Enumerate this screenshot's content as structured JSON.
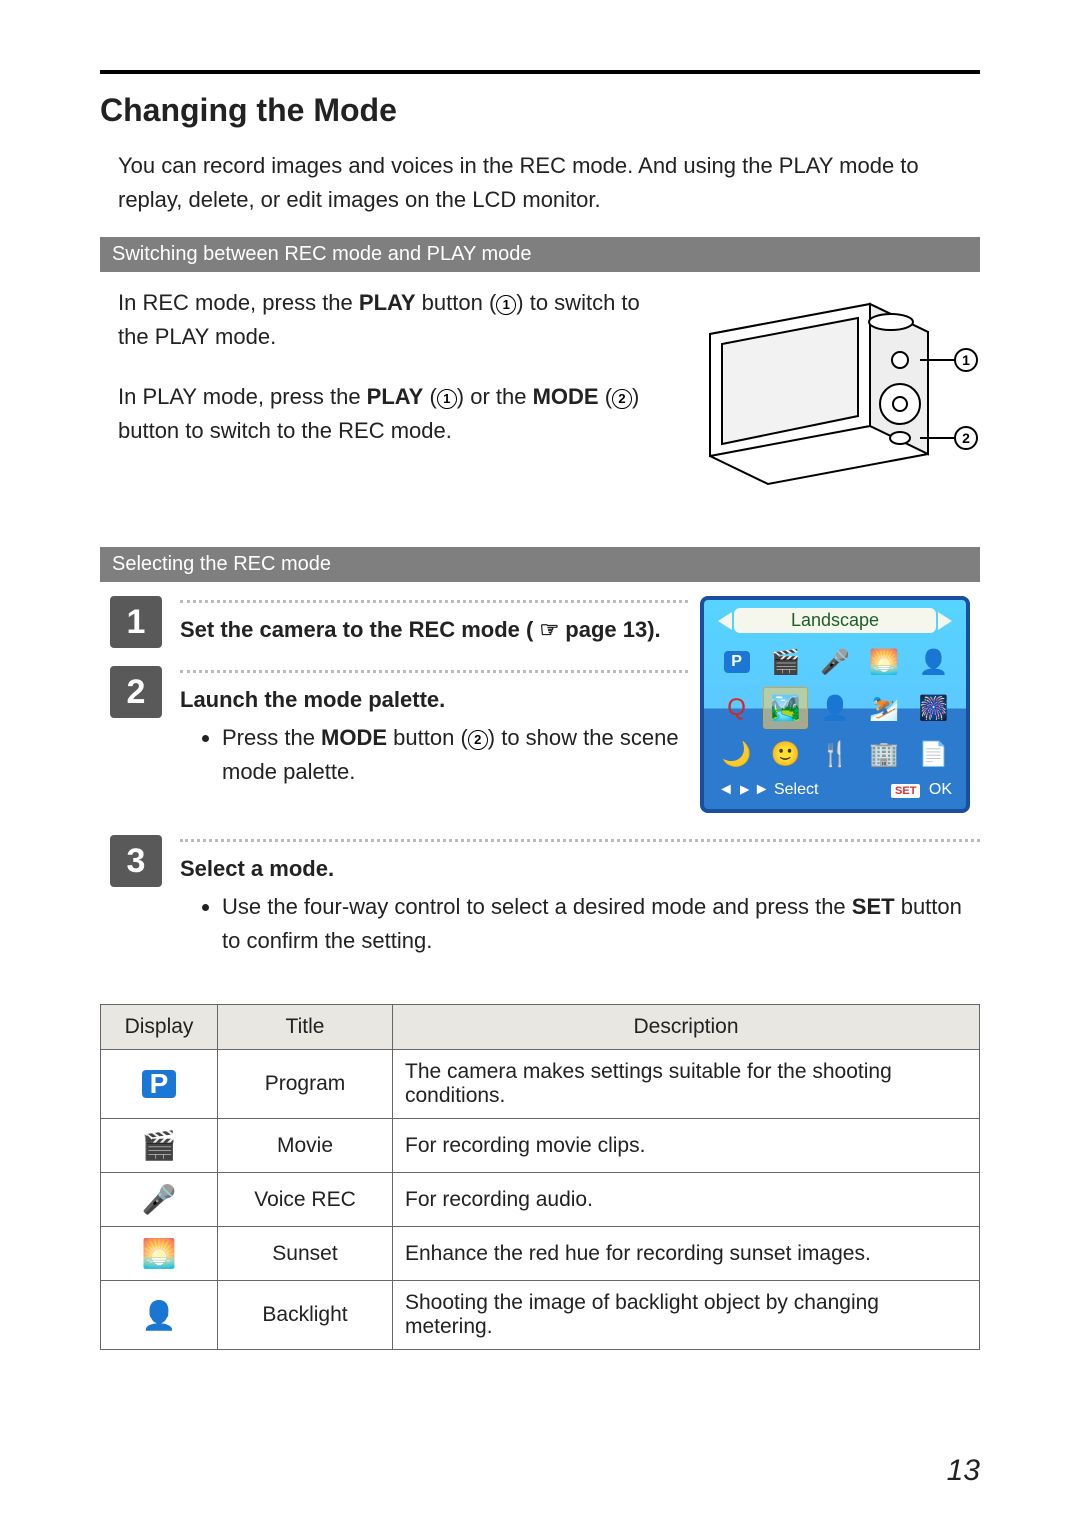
{
  "page_number": "13",
  "title": "Changing the Mode",
  "intro": "You can record images and voices in the REC mode. And using the PLAY mode to replay, delete, or edit images on the LCD monitor.",
  "section1": {
    "heading": "Switching between REC mode and PLAY mode",
    "p1_a": "In REC mode, press the ",
    "p1_b": "PLAY",
    "p1_c": " button (",
    "p1_d": ") to switch to the PLAY mode.",
    "p2_a": "In PLAY mode, press the ",
    "p2_b": "PLAY",
    "p2_c": " (",
    "p2_d": ") or the ",
    "p2_e": "MODE",
    "p2_f": " (",
    "p2_g": ") button to switch to the REC mode.",
    "callout1": "1",
    "callout2": "2"
  },
  "section2": {
    "heading": "Selecting the REC mode",
    "steps": [
      {
        "num": "1",
        "lead": "Set the camera to the REC mode (",
        "trail": "page 13)."
      },
      {
        "num": "2",
        "lead": "Launch the mode palette.",
        "bullet_a": "Press the ",
        "bullet_b": "MODE",
        "bullet_c": " button (",
        "bullet_d": ") to show the scene mode palette."
      },
      {
        "num": "3",
        "lead": "Select a mode.",
        "bullet_a": "Use the four-way control to select a desired mode and press the ",
        "bullet_b": "SET",
        "bullet_c": " button to confirm the setting."
      }
    ],
    "lcd": {
      "title": "Landscape",
      "bottom_left": "Select",
      "bottom_right": "OK",
      "bottom_set": "SET"
    }
  },
  "table": {
    "headers": [
      "Display",
      "Title",
      "Description"
    ],
    "rows": [
      {
        "title": "Program",
        "desc": "The camera makes settings suitable for the shooting conditions."
      },
      {
        "title": "Movie",
        "desc": "For recording movie clips."
      },
      {
        "title": "Voice REC",
        "desc": "For recording audio."
      },
      {
        "title": "Sunset",
        "desc": "Enhance the red hue for recording sunset images."
      },
      {
        "title": "Backlight",
        "desc": "Shooting the image of backlight object by changing metering."
      }
    ]
  }
}
